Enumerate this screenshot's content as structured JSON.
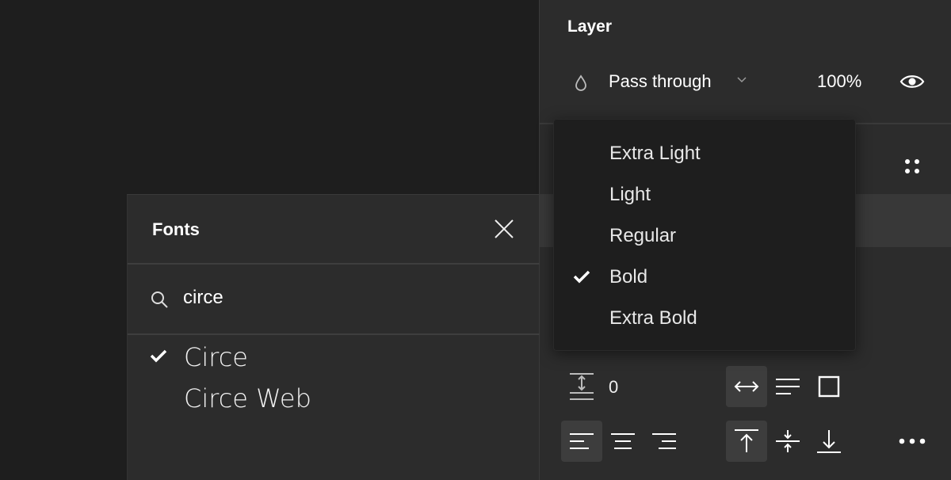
{
  "layer": {
    "title": "Layer",
    "blend_mode": "Pass through",
    "opacity": "100%",
    "icons": {
      "blend": "drop-icon",
      "visibility": "eye-icon",
      "styles": "grid-dots-icon"
    }
  },
  "text_props": {
    "paragraph_spacing": "0",
    "icons": [
      "paragraph-spacing-icon",
      "auto-width-icon",
      "auto-height-icon",
      "fixed-size-icon",
      "align-left-icon",
      "align-center-icon",
      "align-right-icon",
      "align-top-icon",
      "align-middle-icon",
      "align-bottom-icon",
      "more-icon"
    ]
  },
  "weight_menu": {
    "items": [
      {
        "label": "Extra Light",
        "checked": false
      },
      {
        "label": "Light",
        "checked": false
      },
      {
        "label": "Regular",
        "checked": false
      },
      {
        "label": "Bold",
        "checked": true
      },
      {
        "label": "Extra Bold",
        "checked": false
      }
    ]
  },
  "fonts_panel": {
    "title": "Fonts",
    "search_value": "circe",
    "results": [
      {
        "label": "Circe",
        "checked": true
      },
      {
        "label": "Circe Web",
        "checked": false
      }
    ]
  },
  "colors": {
    "canvas": "#1e1e1e",
    "panel": "#2c2c2c",
    "menu": "#1e1e1e",
    "active_button": "#3d3d3d"
  }
}
